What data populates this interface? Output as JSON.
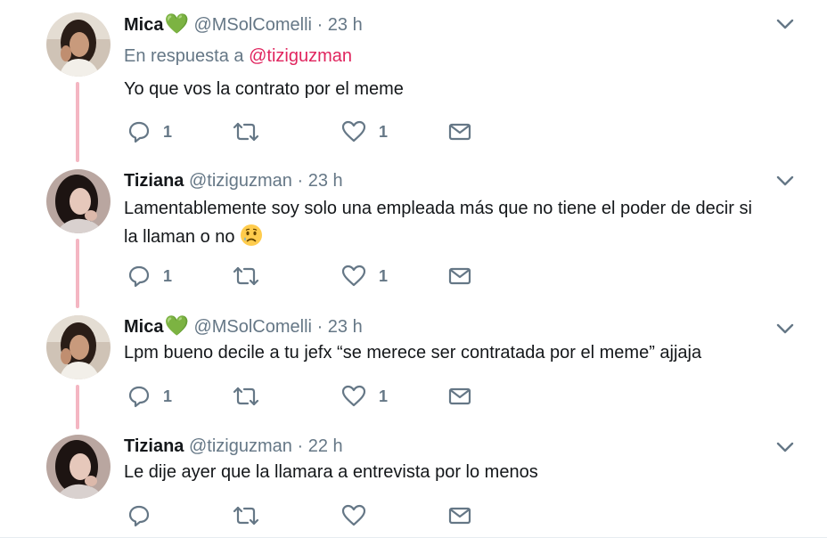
{
  "tweets": [
    {
      "name": "Mica",
      "heart": "💚",
      "handle": "@MSolComelli",
      "time": "23 h",
      "reply_prefix": "En respuesta a",
      "reply_mention": "@tiziguzman",
      "text": "Yo que vos la contrato por el meme",
      "reply_count": "1",
      "like_count": "1"
    },
    {
      "name": "Tiziana",
      "handle": "@tiziguzman",
      "time": "23 h",
      "text_line1": "Lamentablemente soy solo una empleada más que no tiene el poder de decir si",
      "text_line2": "la llaman o no",
      "reply_count": "1",
      "like_count": "1"
    },
    {
      "name": "Mica",
      "heart": "💚",
      "handle": "@MSolComelli",
      "time": "23 h",
      "text": "Lpm bueno decile a tu jefx “se merece ser contratada por el meme” ajjaja",
      "reply_count": "1",
      "like_count": "1"
    },
    {
      "name": "Tiziana",
      "handle": "@tiziguzman",
      "time": "22 h",
      "text": "Le dije ayer que la llamara a entrevista por lo menos"
    }
  ],
  "separator": "·",
  "colors": {
    "thread_line": "#f4b6c2",
    "secondary_text": "#657786",
    "mention": "#e0245e",
    "heart": "#6fbf4a"
  }
}
